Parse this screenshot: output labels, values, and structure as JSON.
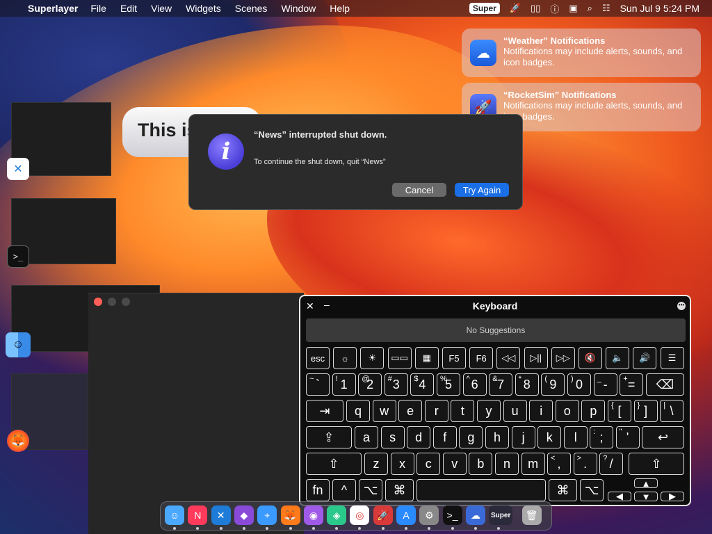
{
  "menubar": {
    "app_name": "Superlayer",
    "items": [
      "File",
      "Edit",
      "View",
      "Widgets",
      "Scenes",
      "Window",
      "Help"
    ],
    "super_badge": "Super",
    "clock": "Sun Jul 9  5:24 PM"
  },
  "notifications": [
    {
      "title": "“Weather” Notifications",
      "body": "Notifications may include alerts, sounds, and icon badges.",
      "icon": "weather-icon"
    },
    {
      "title": "“RocketSim” Notifications",
      "body": "Notifications may include alerts, sounds, and icon badges.",
      "icon": "rocketsim-icon"
    }
  ],
  "bubble": {
    "text": "This is"
  },
  "dialog": {
    "title": "“News” interrupted shut down.",
    "message": "To continue the shut down, quit “News”",
    "cancel_label": "Cancel",
    "try_again_label": "Try Again"
  },
  "keyboard": {
    "title": "Keyboard",
    "suggestions": "No Suggestions",
    "fn_row": [
      "esc",
      "☼",
      "☀",
      "▭▭",
      "▦",
      "F5",
      "F6",
      "◁◁",
      "▷||",
      "▷▷",
      "🔇",
      "🔈",
      "🔊",
      "☰"
    ],
    "number_row": [
      {
        "main": "`",
        "sub": "~"
      },
      {
        "main": "1",
        "sub": "!"
      },
      {
        "main": "2",
        "sub": "@"
      },
      {
        "main": "3",
        "sub": "#"
      },
      {
        "main": "4",
        "sub": "$"
      },
      {
        "main": "5",
        "sub": "%"
      },
      {
        "main": "6",
        "sub": "^"
      },
      {
        "main": "7",
        "sub": "&"
      },
      {
        "main": "8",
        "sub": "*"
      },
      {
        "main": "9",
        "sub": "("
      },
      {
        "main": "0",
        "sub": ")"
      },
      {
        "main": "-",
        "sub": "_"
      },
      {
        "main": "=",
        "sub": "+"
      }
    ],
    "qwerty_row": [
      "q",
      "w",
      "e",
      "r",
      "t",
      "y",
      "u",
      "i",
      "o",
      "p"
    ],
    "qwerty_extra": [
      {
        "main": "[",
        "sub": "{"
      },
      {
        "main": "]",
        "sub": "}"
      },
      {
        "main": "\\",
        "sub": "|"
      }
    ],
    "asdf_row": [
      "a",
      "s",
      "d",
      "f",
      "g",
      "h",
      "j",
      "k",
      "l"
    ],
    "asdf_extra": [
      {
        "main": ";",
        "sub": ":"
      },
      {
        "main": "'",
        "sub": "\""
      }
    ],
    "zxcv_row": [
      "z",
      "x",
      "c",
      "v",
      "b",
      "n",
      "m"
    ],
    "zxcv_extra": [
      {
        "main": ",",
        "sub": "<"
      },
      {
        "main": ".",
        "sub": ">"
      },
      {
        "main": "/",
        "sub": "?"
      }
    ],
    "bottom": {
      "fn": "fn",
      "ctrl": "^",
      "opt": "⌥",
      "cmd": "⌘"
    }
  },
  "dock": {
    "apps": [
      "finder-icon",
      "news-icon",
      "vscode-icon",
      "visual-studio-icon",
      "safari-icon",
      "firefox-icon",
      "podcasts-icon",
      "sourcetree-icon",
      "chrome-icon",
      "rocketsim-icon",
      "app-store-icon",
      "system-settings-icon",
      "terminal-icon",
      "weather-icon",
      "superlayer-icon",
      "trash-icon"
    ],
    "super_label": "Super"
  }
}
